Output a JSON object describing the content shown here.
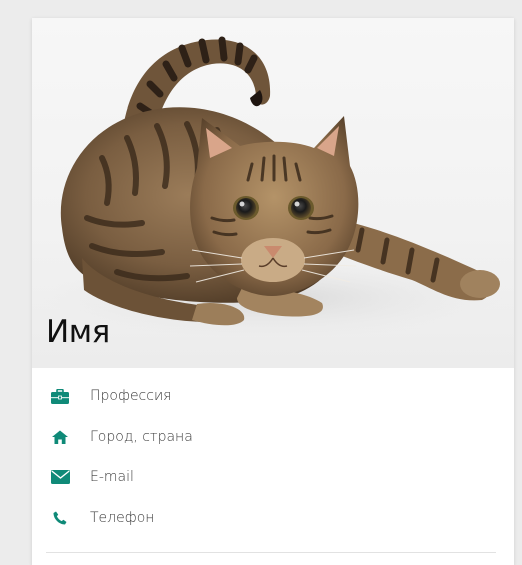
{
  "profile": {
    "name": "Имя",
    "photo_icon": "cat-photo",
    "accent_color": "#0f8a78"
  },
  "info": [
    {
      "icon": "briefcase-icon",
      "label": "Профессия"
    },
    {
      "icon": "home-icon",
      "label": "Город, страна"
    },
    {
      "icon": "envelope-icon",
      "label": "E-mail"
    },
    {
      "icon": "phone-icon",
      "label": "Телефон"
    }
  ]
}
